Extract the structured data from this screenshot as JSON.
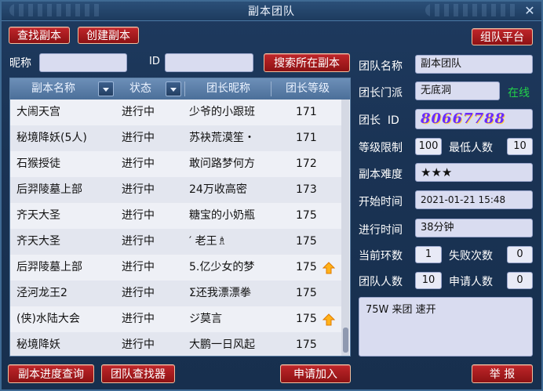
{
  "window": {
    "title": "副本团队"
  },
  "toolbar": {
    "find_dungeon": "查找副本",
    "create_dungeon": "创建副本",
    "team_platform": "组队平台"
  },
  "search": {
    "nickname_label": "昵称",
    "nickname_value": "",
    "id_label": "ID",
    "id_value": "",
    "search_button": "搜索所在副本"
  },
  "table": {
    "headers": [
      "副本名称",
      "状态",
      "团长昵称",
      "团长等级"
    ],
    "rows": [
      {
        "name": "大闹天宫",
        "status": "进行中",
        "leader": "少爷的小跟班",
        "level": "171",
        "up": false
      },
      {
        "name": "秘境降妖(5人)",
        "status": "进行中",
        "leader": "苏袂荒漠笙・",
        "level": "171",
        "up": false
      },
      {
        "name": "石猴授徒",
        "status": "进行中",
        "leader": "敢问路梦何方",
        "level": "172",
        "up": false
      },
      {
        "name": "后羿陵墓上部",
        "status": "进行中",
        "leader": "24万收高密",
        "level": "173",
        "up": false
      },
      {
        "name": "齐天大圣",
        "status": "进行中",
        "leader": "糖宝的小奶瓶",
        "level": "175",
        "up": false
      },
      {
        "name": "齐天大圣",
        "status": "进行中",
        "leader": "′ 老王♗",
        "level": "175",
        "up": false
      },
      {
        "name": "后羿陵墓上部",
        "status": "进行中",
        "leader": "5.亿少女的梦",
        "level": "175",
        "up": true
      },
      {
        "name": "泾河龙王2",
        "status": "进行中",
        "leader": "Σ还我漂漂拳",
        "level": "175",
        "up": false
      },
      {
        "name": "(侠)水陆大会",
        "status": "进行中",
        "leader": "ジ莫言",
        "level": "175",
        "up": true
      },
      {
        "name": "秘境降妖",
        "status": "进行中",
        "leader": "大鹏一日风起",
        "level": "175",
        "up": false
      }
    ]
  },
  "detail": {
    "team_name_label": "团队名称",
    "team_name": "副本团队",
    "leader_school_label": "团长门派",
    "leader_school": "无底洞",
    "online": "在线",
    "leader_id_label": "团长  ID",
    "leader_id": "80667788",
    "level_limit_label": "等级限制",
    "level_limit": "100",
    "min_people_label": "最低人数",
    "min_people": "10",
    "difficulty_label": "副本难度",
    "difficulty": "★★★",
    "start_time_label": "开始时间",
    "start_time": "2021-01-21 15:48",
    "elapsed_label": "进行时间",
    "elapsed": "38分钟",
    "current_round_label": "当前环数",
    "current_round": "1",
    "fail_count_label": "失败次数",
    "fail_count": "0",
    "team_count_label": "团队人数",
    "team_count": "10",
    "applicants_label": "申请人数",
    "applicants": "0",
    "notice": "75W 来团 速开"
  },
  "footer": {
    "progress_query": "副本进度查询",
    "team_finder": "团队查找器",
    "apply_join": "申请加入",
    "report": "举 报"
  },
  "colors": {
    "button_red": "#a81b1e",
    "online_green": "#22d24a",
    "header_blue": "#5a7ea8"
  }
}
